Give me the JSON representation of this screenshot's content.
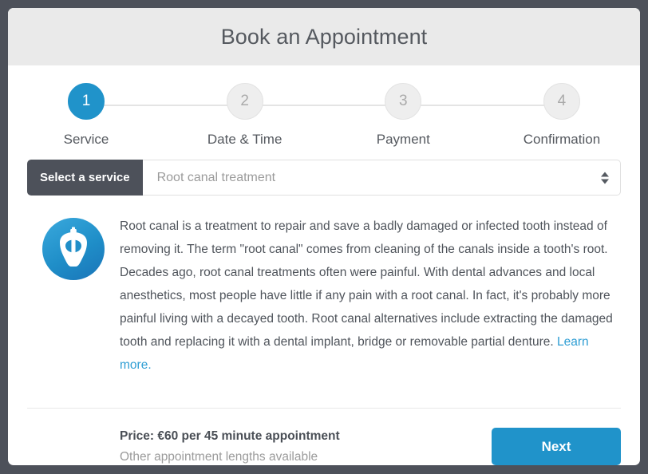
{
  "header": {
    "title": "Book an Appointment"
  },
  "stepper": {
    "steps": [
      {
        "number": "1",
        "label": "Service",
        "state": "active"
      },
      {
        "number": "2",
        "label": "Date & Time",
        "state": "inactive"
      },
      {
        "number": "3",
        "label": "Payment",
        "state": "inactive"
      },
      {
        "number": "4",
        "label": "Confirmation",
        "state": "inactive"
      }
    ]
  },
  "service_select": {
    "label": "Select a service",
    "value": "Root canal treatment",
    "placeholder": "Select a service",
    "arrow_icon": "updown-arrows-icon"
  },
  "service": {
    "icon_name": "tooth-root-canal-icon",
    "description": "Root canal is a treatment to repair and save a badly damaged or infected tooth instead of removing it. The term \"root canal\" comes from cleaning of the canals inside a tooth's root. Decades ago, root canal treatments often were painful. With dental advances and local anesthetics, most people have little if any pain with a root canal. In fact, it's probably more painful living with a decayed tooth. Root canal alternatives include extracting the damaged tooth and replacing it with a dental implant, bridge or removable partial denture. ",
    "learn_more": "Learn more."
  },
  "footer": {
    "price": "Price: €60 per 45 minute appointment",
    "price_note": "Other appointment lengths available",
    "next_label": "Next"
  },
  "colors": {
    "accent": "#2093ca",
    "dark": "#4d515a",
    "header_bg": "#eaeaea",
    "link": "#2f9ed4",
    "muted": "#9b9b9b"
  }
}
